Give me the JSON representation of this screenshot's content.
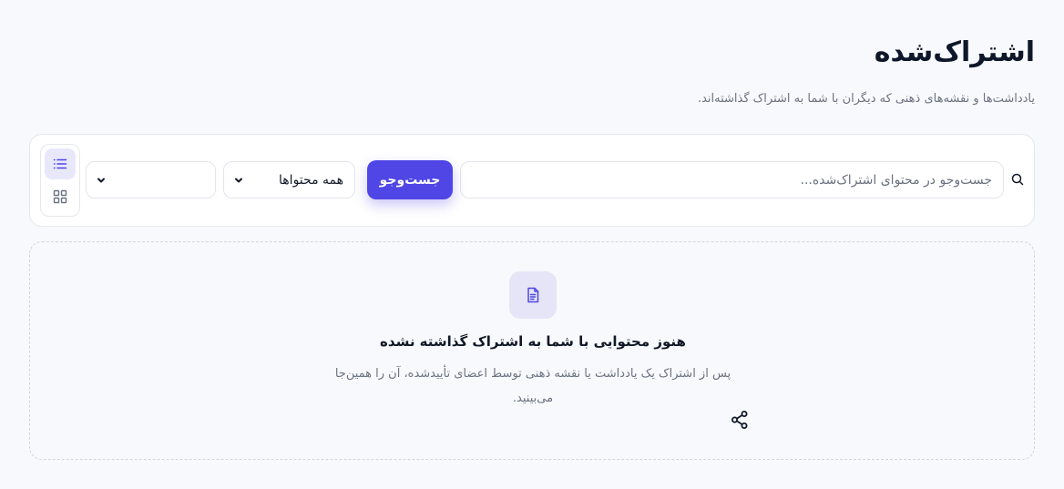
{
  "header": {
    "title": "اشتراک‌شده",
    "subtitle": "یادداشت‌ها و نقشه‌های ذهنی که دیگران با شما به اشتراک گذاشته‌اند."
  },
  "toolbar": {
    "search_placeholder": "جست‌وجو در محتوای اشتراک‌شده...",
    "search_value": "",
    "search_button_label": "جست‌وجو",
    "type_filter_selected": "همه محتواها",
    "second_filter_selected": "",
    "view_modes": [
      "list-icon",
      "grid-icon"
    ],
    "active_view": "list"
  },
  "empty_state": {
    "icon": "document-icon",
    "title": "هنوز محتوایی با شما به اشتراک گذاشته نشده",
    "description": "پس از اشتراک یک یادداشت یا نقشه ذهنی توسط اعضای تأییدشده، آن را همین‌جا می‌بینید.",
    "decoration_icon": "share-icon"
  },
  "colors": {
    "accent": "#4f46e5",
    "accent_soft": "#e9e8fb",
    "background": "#f8f9fc",
    "text_primary": "#111827",
    "text_muted": "#6b7280"
  }
}
